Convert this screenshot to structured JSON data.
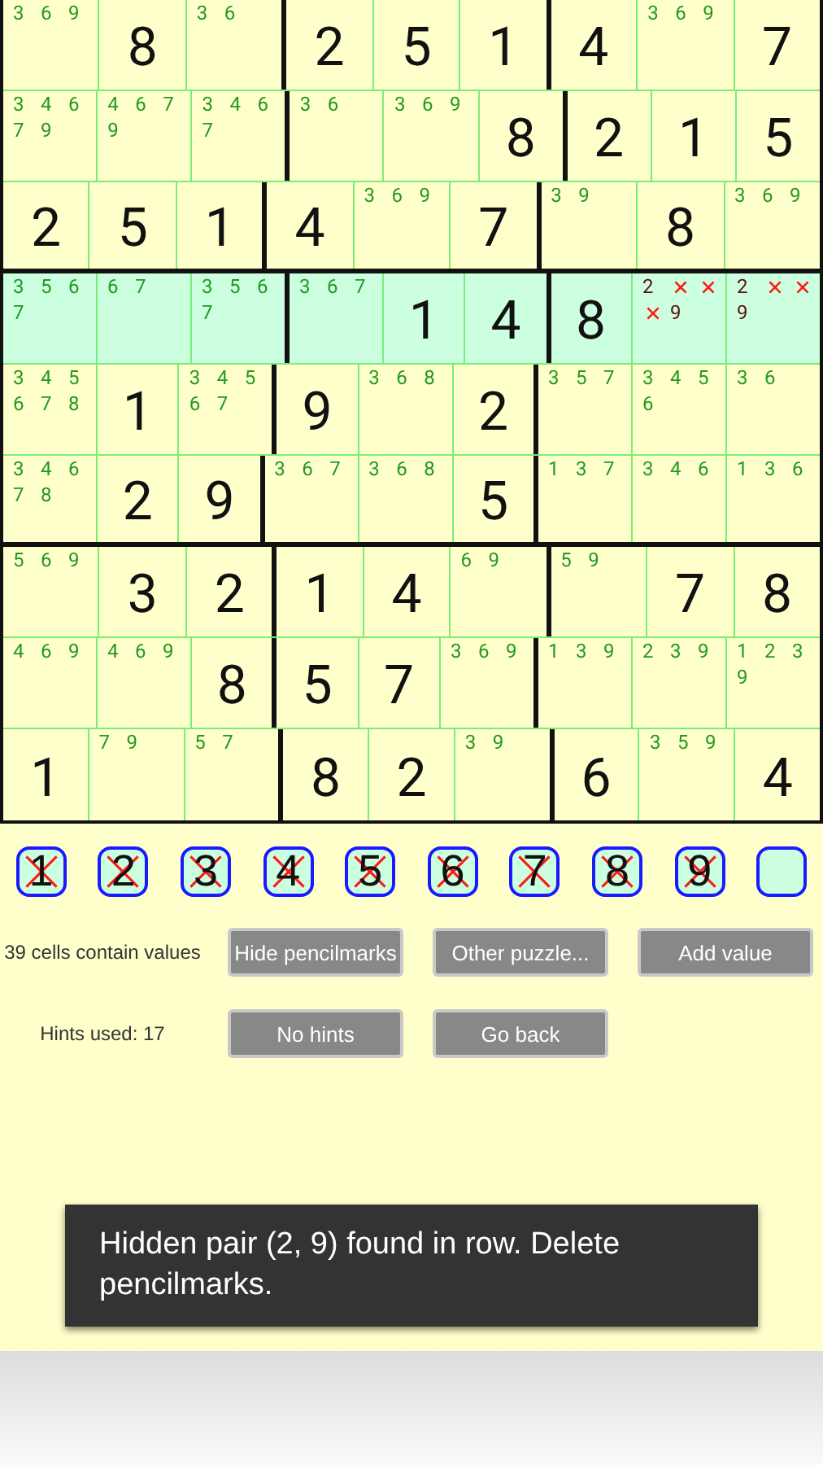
{
  "grid": {
    "rows": [
      {
        "highlighted": false,
        "cells": [
          {
            "marks": [
              "3",
              "6",
              "9"
            ]
          },
          {
            "value": "8"
          },
          {
            "marks": [
              "3",
              "6"
            ]
          },
          {
            "value": "2"
          },
          {
            "value": "5"
          },
          {
            "value": "1"
          },
          {
            "value": "4"
          },
          {
            "marks": [
              "3",
              "6",
              "9"
            ]
          },
          {
            "value": "7"
          }
        ]
      },
      {
        "highlighted": false,
        "cells": [
          {
            "marks": [
              "3",
              "4",
              "6",
              "7",
              "9"
            ]
          },
          {
            "marks": [
              "4",
              "6",
              "7",
              "9"
            ]
          },
          {
            "marks": [
              "3",
              "4",
              "6",
              "7"
            ]
          },
          {
            "marks": [
              "3",
              "6"
            ]
          },
          {
            "marks": [
              "3",
              "6",
              "9"
            ]
          },
          {
            "value": "8"
          },
          {
            "value": "2"
          },
          {
            "value": "1"
          },
          {
            "value": "5"
          }
        ]
      },
      {
        "highlighted": false,
        "cells": [
          {
            "value": "2"
          },
          {
            "value": "5"
          },
          {
            "value": "1"
          },
          {
            "value": "4"
          },
          {
            "marks": [
              "3",
              "6",
              "9"
            ]
          },
          {
            "value": "7"
          },
          {
            "marks": [
              "3",
              "9"
            ]
          },
          {
            "value": "8"
          },
          {
            "marks": [
              "3",
              "6",
              "9"
            ]
          }
        ]
      },
      {
        "highlighted": true,
        "cells": [
          {
            "marks": [
              "3",
              "5",
              "6",
              "7"
            ]
          },
          {
            "marks": [
              "6",
              "7"
            ]
          },
          {
            "marks": [
              "3",
              "5",
              "6",
              "7"
            ]
          },
          {
            "marks": [
              "3",
              "6",
              "7"
            ]
          },
          {
            "value": "1"
          },
          {
            "value": "4"
          },
          {
            "value": "8"
          },
          {
            "hint_marks": [
              {
                "kind": "digit",
                "text": "2"
              },
              {
                "kind": "struck"
              },
              {
                "kind": "struck"
              },
              {
                "kind": "struck"
              },
              {
                "kind": "digit",
                "text": "9"
              }
            ]
          },
          {
            "hint_marks": [
              {
                "kind": "digit",
                "text": "2"
              },
              {
                "kind": "struck"
              },
              {
                "kind": "struck"
              },
              {
                "kind": "digit",
                "text": "9"
              }
            ]
          }
        ]
      },
      {
        "highlighted": false,
        "cells": [
          {
            "marks": [
              "3",
              "4",
              "5",
              "6",
              "7",
              "8"
            ]
          },
          {
            "value": "1"
          },
          {
            "marks": [
              "3",
              "4",
              "5",
              "6",
              "7"
            ]
          },
          {
            "value": "9"
          },
          {
            "marks": [
              "3",
              "6",
              "8"
            ]
          },
          {
            "value": "2"
          },
          {
            "marks": [
              "3",
              "5",
              "7"
            ]
          },
          {
            "marks": [
              "3",
              "4",
              "5",
              "6"
            ]
          },
          {
            "marks": [
              "3",
              "6"
            ]
          }
        ]
      },
      {
        "highlighted": false,
        "cells": [
          {
            "marks": [
              "3",
              "4",
              "6",
              "7",
              "8"
            ]
          },
          {
            "value": "2"
          },
          {
            "value": "9"
          },
          {
            "marks": [
              "3",
              "6",
              "7"
            ]
          },
          {
            "marks": [
              "3",
              "6",
              "8"
            ]
          },
          {
            "value": "5"
          },
          {
            "marks": [
              "1",
              "3",
              "7"
            ]
          },
          {
            "marks": [
              "3",
              "4",
              "6"
            ]
          },
          {
            "marks": [
              "1",
              "3",
              "6"
            ]
          }
        ]
      },
      {
        "highlighted": false,
        "cells": [
          {
            "marks": [
              "5",
              "6",
              "9"
            ]
          },
          {
            "value": "3"
          },
          {
            "value": "2"
          },
          {
            "value": "1"
          },
          {
            "value": "4"
          },
          {
            "marks": [
              "6",
              "9"
            ]
          },
          {
            "marks": [
              "5",
              "9"
            ]
          },
          {
            "value": "7"
          },
          {
            "value": "8"
          }
        ]
      },
      {
        "highlighted": false,
        "cells": [
          {
            "marks": [
              "4",
              "6",
              "9"
            ]
          },
          {
            "marks": [
              "4",
              "6",
              "9"
            ]
          },
          {
            "value": "8"
          },
          {
            "value": "5"
          },
          {
            "value": "7"
          },
          {
            "marks": [
              "3",
              "6",
              "9"
            ]
          },
          {
            "marks": [
              "1",
              "3",
              "9"
            ]
          },
          {
            "marks": [
              "2",
              "3",
              "9"
            ]
          },
          {
            "marks": [
              "1",
              "2",
              "3",
              "9"
            ]
          }
        ]
      },
      {
        "highlighted": false,
        "cells": [
          {
            "value": "1"
          },
          {
            "marks": [
              "7",
              "9"
            ]
          },
          {
            "marks": [
              "5",
              "7"
            ]
          },
          {
            "value": "8"
          },
          {
            "value": "2"
          },
          {
            "marks": [
              "3",
              "9"
            ]
          },
          {
            "value": "6"
          },
          {
            "marks": [
              "3",
              "5",
              "9"
            ]
          },
          {
            "value": "4"
          }
        ]
      }
    ]
  },
  "digit_buttons": [
    {
      "label": "1",
      "struck": true
    },
    {
      "label": "2",
      "struck": true
    },
    {
      "label": "3",
      "struck": true
    },
    {
      "label": "4",
      "struck": true
    },
    {
      "label": "5",
      "struck": true
    },
    {
      "label": "6",
      "struck": true
    },
    {
      "label": "7",
      "struck": true
    },
    {
      "label": "8",
      "struck": true
    },
    {
      "label": "9",
      "struck": true
    },
    {
      "struck": false
    }
  ],
  "status": "39 cells contain values",
  "buttons_row_1": [
    "Hide pencilmarks",
    "Other puzzle...",
    "Add value"
  ],
  "hints_used": "Hints used: 17",
  "buttons_row_2": [
    "No hints",
    "Go back"
  ],
  "toast": "Hidden pair (2, 9) found in row. Delete pencilmarks."
}
